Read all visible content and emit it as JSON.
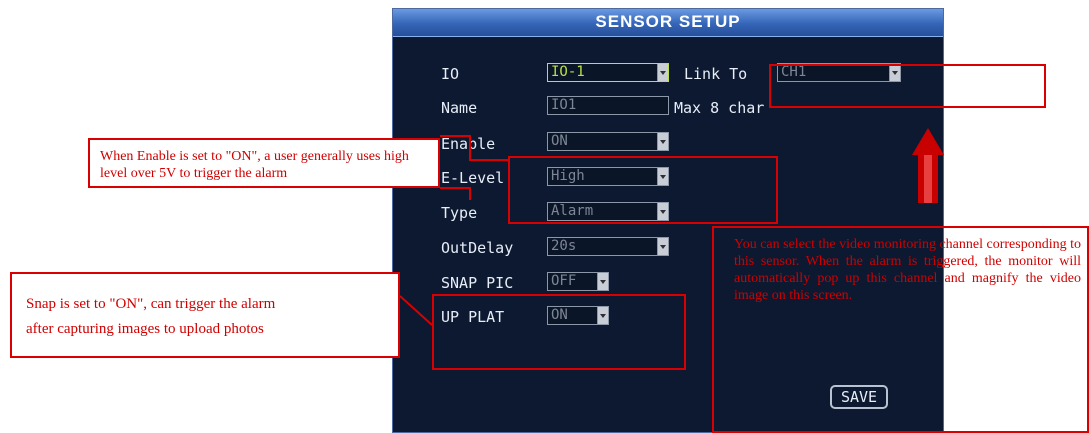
{
  "dialog": {
    "title": "SENSOR SETUP",
    "io": {
      "label": "IO",
      "value": "IO-1"
    },
    "link_to": {
      "label": "Link To",
      "value": "CH1"
    },
    "name": {
      "label": "Name",
      "value": "IO1",
      "hint": "Max 8 char"
    },
    "enable": {
      "label": "Enable",
      "value": "ON"
    },
    "e_level": {
      "label": "E-Level",
      "value": "High"
    },
    "type": {
      "label": "Type",
      "value": "Alarm"
    },
    "out_delay": {
      "label": "OutDelay",
      "value": "20s"
    },
    "snap_pic": {
      "label": "SNAP PIC",
      "value": "OFF"
    },
    "up_plat": {
      "label": "UP PLAT",
      "value": "ON"
    },
    "save_label": "SAVE"
  },
  "annotations": {
    "enable_note": "When Enable is set to \"ON\", a user generally uses high level over 5V to trigger the alarm",
    "snap_note_line1": "Snap is set to \"ON\", can trigger the alarm",
    "snap_note_line2": "after capturing images to upload photos",
    "channel_note": "You can select the video monitoring channel corresponding to this sensor. When the alarm is triggered, the monitor will automatically pop up this channel and magnify the video image on this screen."
  },
  "colors": {
    "annotation_red": "#d80000",
    "dialog_bg": "#0c1930",
    "title_blue": "#3465b8",
    "active_green": "#b9e04a"
  }
}
